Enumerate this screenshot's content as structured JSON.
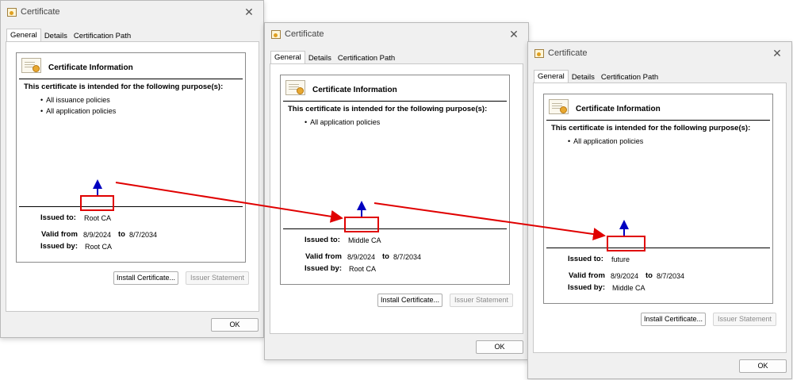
{
  "windows": [
    {
      "title": "Certificate",
      "tabs": [
        "General",
        "Details",
        "Certification Path"
      ],
      "info_title": "Certificate Information",
      "purpose_heading": "This certificate is intended for the following purpose(s):",
      "purposes": [
        "All issuance policies",
        "All application policies"
      ],
      "issued_to_label": "Issued to:",
      "issued_to": "Root CA",
      "issued_by_label": "Issued by:",
      "issued_by": "Root CA",
      "valid_from_label": "Valid from",
      "valid_from": "8/9/2024",
      "to_label": "to",
      "valid_to": "8/7/2034",
      "install_button": "Install Certificate...",
      "issuer_button": "Issuer Statement",
      "ok_button": "OK"
    },
    {
      "title": "Certificate",
      "tabs": [
        "General",
        "Details",
        "Certification Path"
      ],
      "info_title": "Certificate Information",
      "purpose_heading": "This certificate is intended for the following purpose(s):",
      "purposes": [
        "All application policies"
      ],
      "issued_to_label": "Issued to:",
      "issued_to": "Middle CA",
      "issued_by_label": "Issued by:",
      "issued_by": "Root CA",
      "valid_from_label": "Valid from",
      "valid_from": "8/9/2024",
      "to_label": "to",
      "valid_to": "8/7/2034",
      "install_button": "Install Certificate...",
      "issuer_button": "Issuer Statement",
      "ok_button": "OK"
    },
    {
      "title": "Certificate",
      "tabs": [
        "General",
        "Details",
        "Certification Path"
      ],
      "info_title": "Certificate Information",
      "purpose_heading": "This certificate is intended for the following purpose(s):",
      "purposes": [
        "All application policies"
      ],
      "issued_to_label": "Issued to:",
      "issued_to": "future",
      "issued_by_label": "Issued by:",
      "issued_by": "Middle CA",
      "valid_from_label": "Valid from",
      "valid_from": "8/9/2024",
      "to_label": "to",
      "valid_to": "8/7/2034",
      "install_button": "Install Certificate...",
      "issuer_button": "Issuer Statement",
      "ok_button": "OK"
    }
  ],
  "annotation_colors": {
    "highlight": "#e00000",
    "link_arrow": "#e00000",
    "up_arrow": "#0000c0"
  }
}
